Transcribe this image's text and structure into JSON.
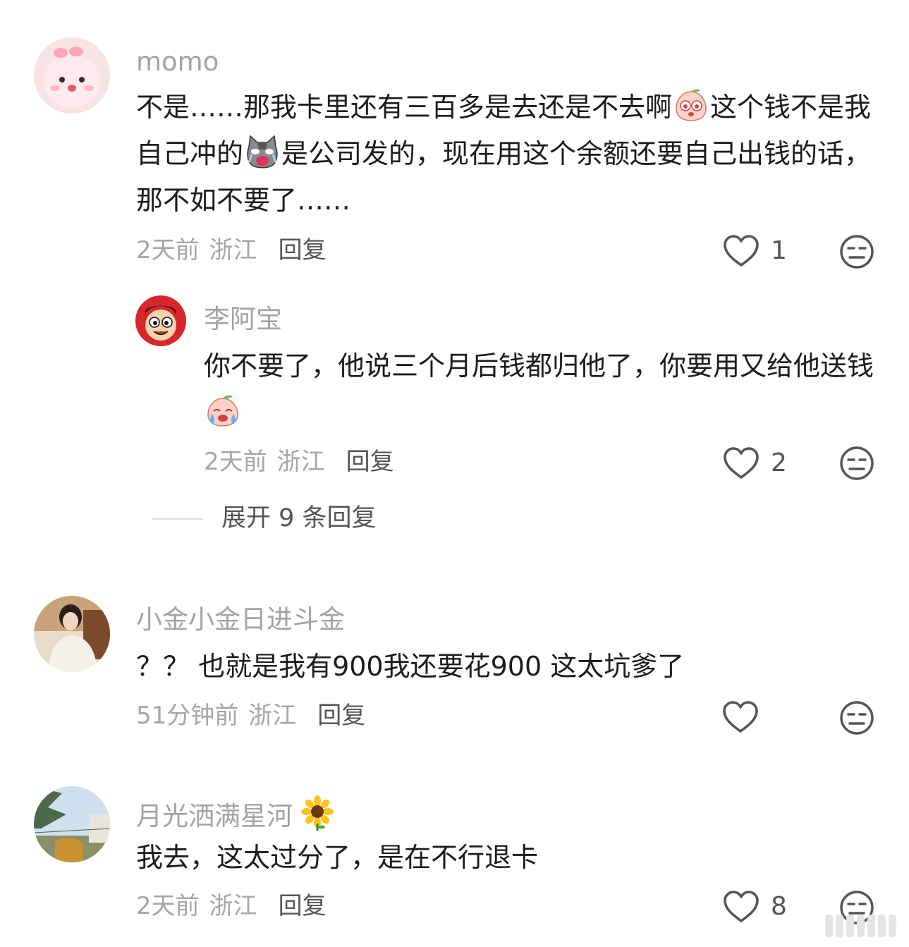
{
  "comments": [
    {
      "author": "momo",
      "text_parts": [
        "不是……那我卡里还有三百多是去还是不去啊",
        "这个钱不是我自己冲的",
        "是公司发的，现在用这个余额还要自己出钱的话，那不如不要了……"
      ],
      "time": "2天前",
      "region": "浙江",
      "reply_label": "回复",
      "likes": "1"
    },
    {
      "author": "李阿宝",
      "text_parts": [
        "你不要了，他说三个月后钱都归他了，你要用又给他送钱"
      ],
      "time": "2天前",
      "region": "浙江",
      "reply_label": "回复",
      "likes": "2"
    },
    {
      "author": "小金小金日进斗金",
      "text_parts": [
        "？？ 也就是我有900我还要花900  这太坑爹了"
      ],
      "time": "51分钟前",
      "region": "浙江",
      "reply_label": "回复",
      "likes": ""
    },
    {
      "author": "月光洒满星河",
      "text_parts": [
        "我去，这太过分了，是在不行退卡"
      ],
      "time": "2天前",
      "region": "浙江",
      "reply_label": "回复",
      "likes": "8"
    }
  ],
  "expand_replies": "展开 9 条回复",
  "icons": {
    "like": "heart-outline-icon",
    "dislike": "meh-face-icon",
    "sticker_peach": "peach-sticker-icon",
    "sticker_cat": "crying-cat-sticker-icon",
    "sticker_peach_cry": "crying-peach-sticker-icon",
    "sunflower": "sunflower-emoji-icon"
  }
}
